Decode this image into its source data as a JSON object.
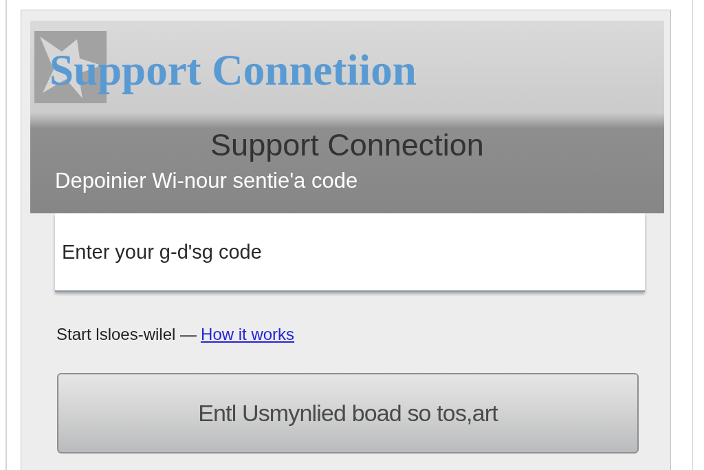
{
  "header": {
    "logo_text": "Support Connetiion",
    "title": "Support Connection",
    "subtitle": "Depoinier Wi-nour sentie'a code"
  },
  "code_field": {
    "placeholder": "Enter your g-d'sg code"
  },
  "help_line": {
    "text": "Start lsloes-wilel —",
    "link": "How it works"
  },
  "buttons": [
    {
      "label": "Entl Usmynlied boad so tos,art"
    }
  ]
}
